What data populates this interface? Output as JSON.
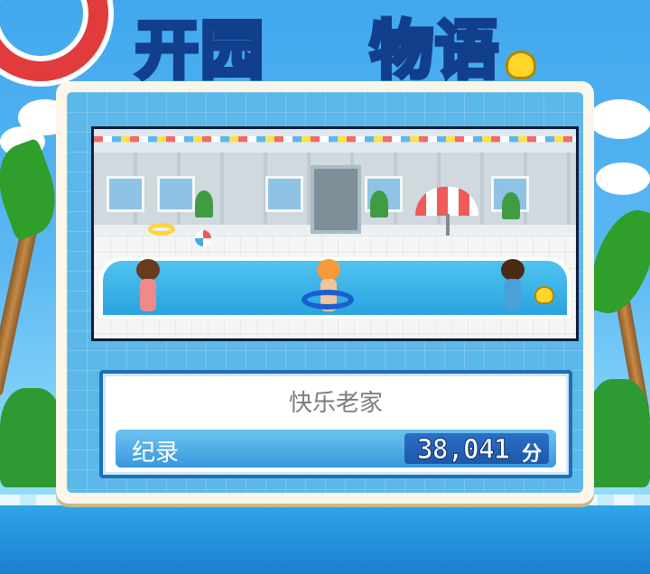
{
  "logo": {
    "line1": "开园",
    "line2": "物语"
  },
  "scene": {
    "characters": [
      "girl-red-swimsuit",
      "boy-in-blue-tube",
      "boy-blue-shirt"
    ]
  },
  "info": {
    "park_name": "快乐老家",
    "record_label": "纪录",
    "score": "38,041",
    "score_unit": "分"
  },
  "colors": {
    "panel_bg": "#5cb8e8",
    "accent_blue": "#1e6fb4",
    "score_bg": "#2a6fc8"
  }
}
